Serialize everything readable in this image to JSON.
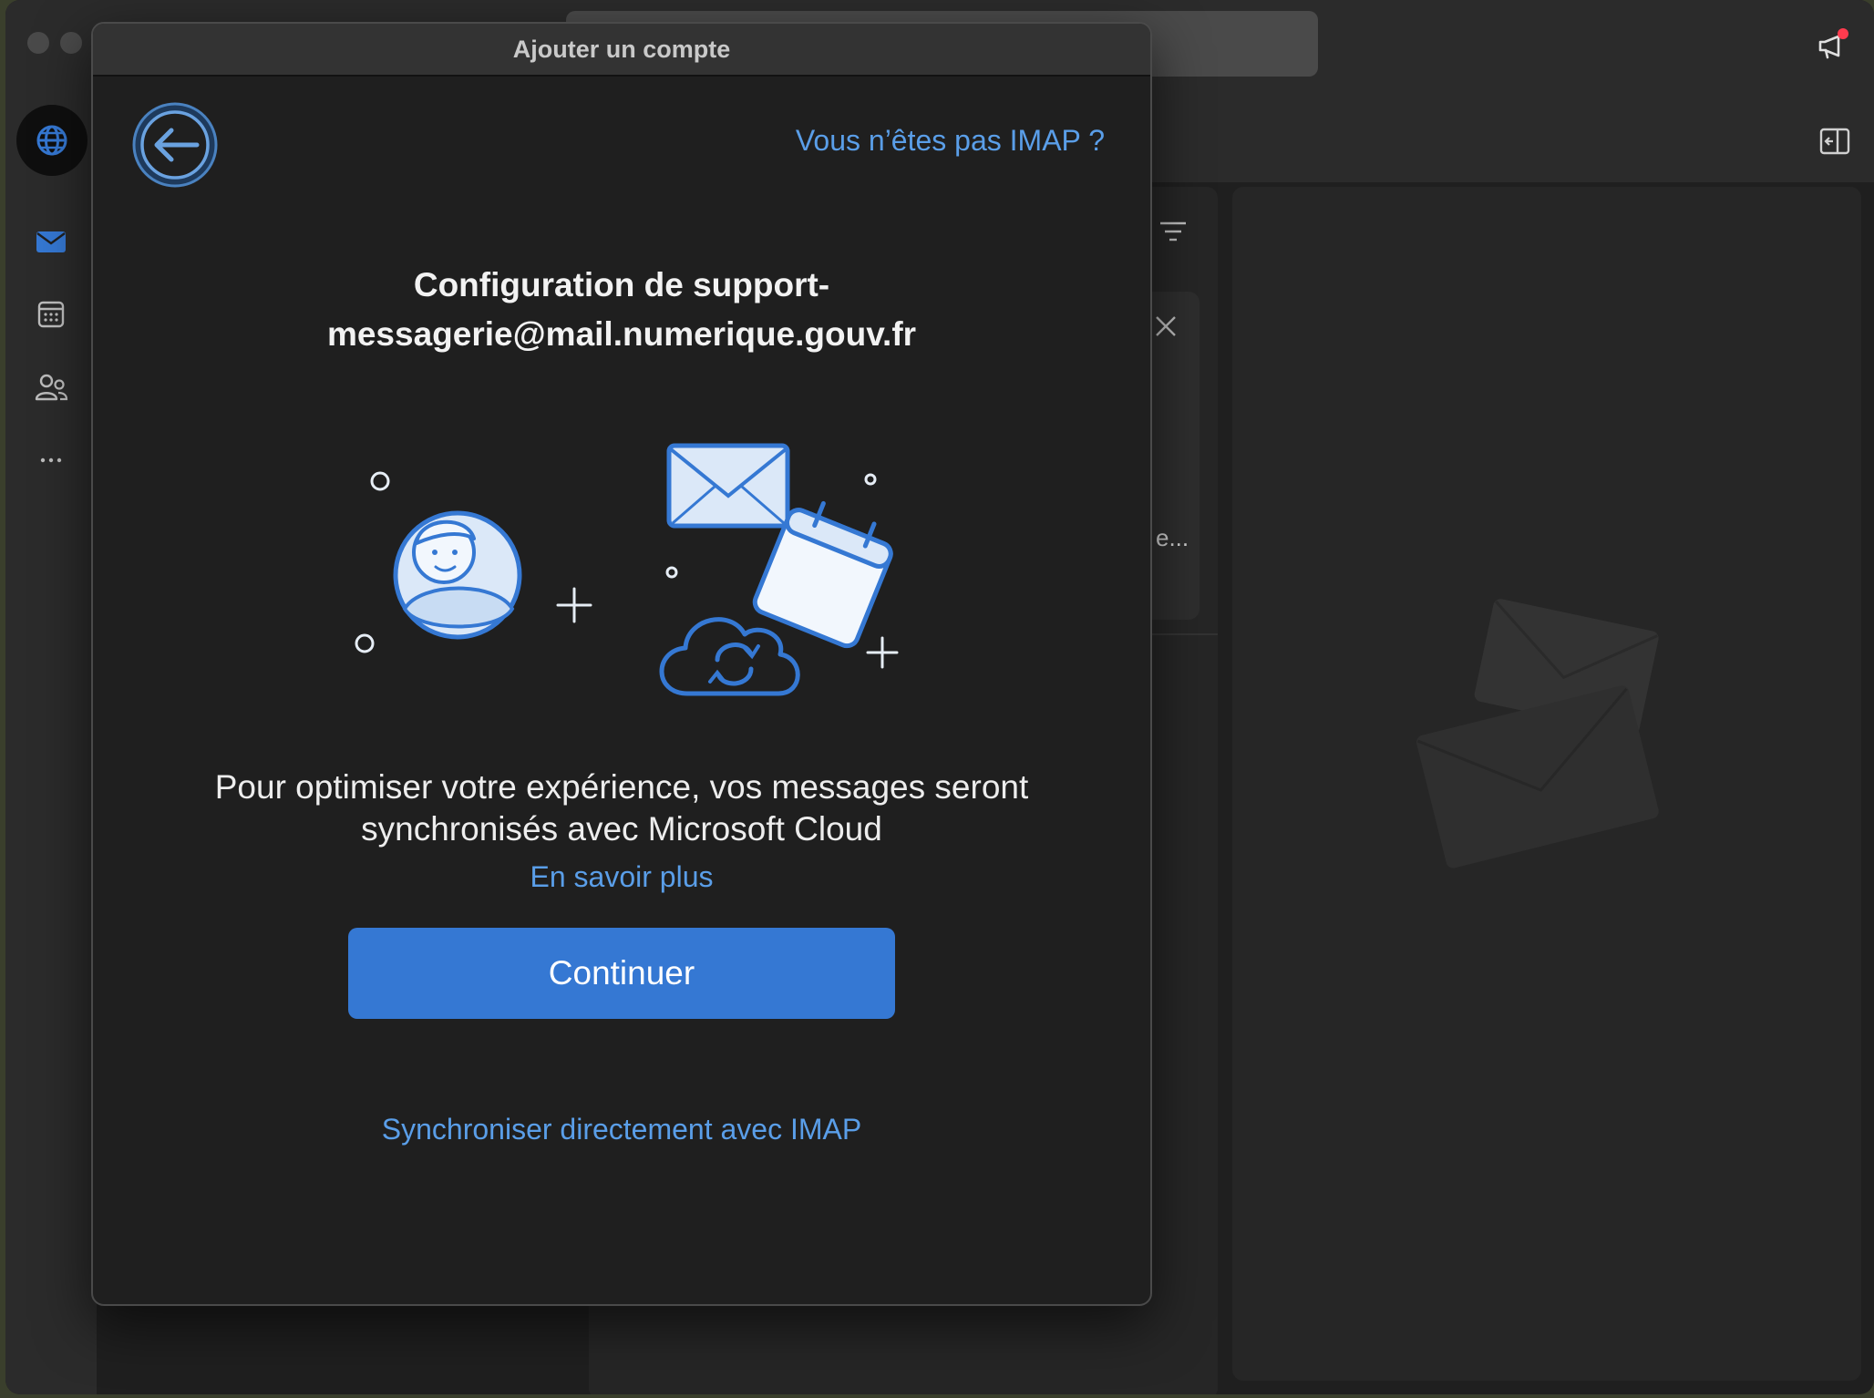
{
  "dialog": {
    "title": "Ajouter un compte",
    "not_imap_link": "Vous n’êtes pas IMAP ?",
    "heading_line1": "Configuration de support-",
    "heading_line2": "messagerie@mail.numerique.gouv.fr",
    "body_line1": "Pour optimiser votre expérience, vos messages seront",
    "body_line2": "synchronisés avec Microsoft Cloud",
    "learn_more": "En savoir plus",
    "continue_button": "Continuer",
    "imap_sync_link": "Synchroniser directement avec IMAP"
  },
  "background": {
    "card_snippet": "e..."
  },
  "colors": {
    "accent": "#3578d3",
    "link": "#5a9ee8",
    "dialog_bg": "#1f1f1f",
    "notification_dot": "#ff3b4e"
  },
  "icons": {
    "back": "back-arrow-icon",
    "globe": "globe-icon",
    "mail": "mail-icon",
    "calendar": "calendar-icon",
    "people": "people-icon",
    "more": "more-icon",
    "megaphone": "megaphone-icon",
    "panel": "panel-toggle-icon",
    "filter": "filter-icon",
    "close": "close-icon"
  }
}
